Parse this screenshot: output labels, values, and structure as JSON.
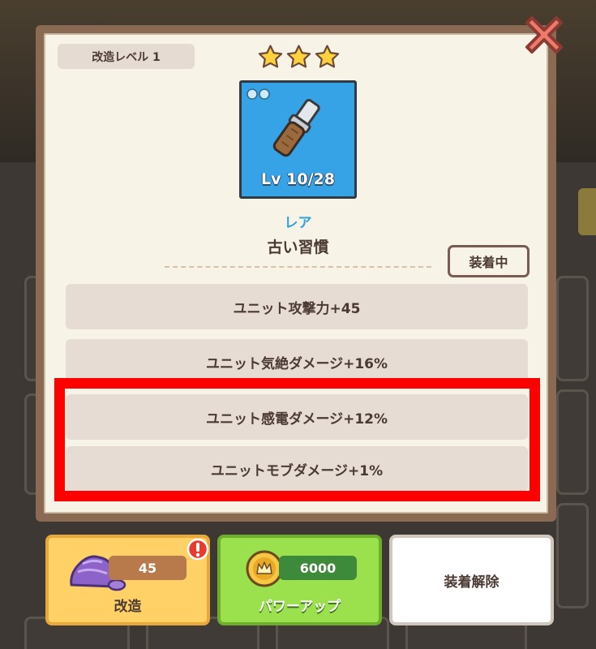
{
  "dialog": {
    "modify_level": "改造レベル 1",
    "star_count": 3,
    "item": {
      "level_text": "Lv 10/28",
      "rarity": "レア",
      "name": "古い習慣",
      "card_color": "#36a3e6",
      "icon": "old-knife-handle-icon"
    },
    "equipped_label": "装着中",
    "stats": [
      "ユニット攻撃力+45",
      "ユニット気絶ダメージ+16%",
      "ユニット感電ダメージ+12%",
      "ユニットモブダメージ+1%"
    ],
    "highlight_color": "#ff0000"
  },
  "actions": {
    "modify": {
      "count": "45",
      "label": "改造",
      "icon": "ore-icon"
    },
    "powerup": {
      "price": "6000",
      "label": "パワーアップ",
      "icon": "gold-coin-icon"
    },
    "unequip": {
      "label": "装着解除"
    }
  },
  "colors": {
    "text_dark": "#4b3a33",
    "panel_bg": "#f7f3e6",
    "modify_btn": "#ffd166",
    "powerup_btn": "#9be04d",
    "close_btn": "#f07a6a"
  }
}
